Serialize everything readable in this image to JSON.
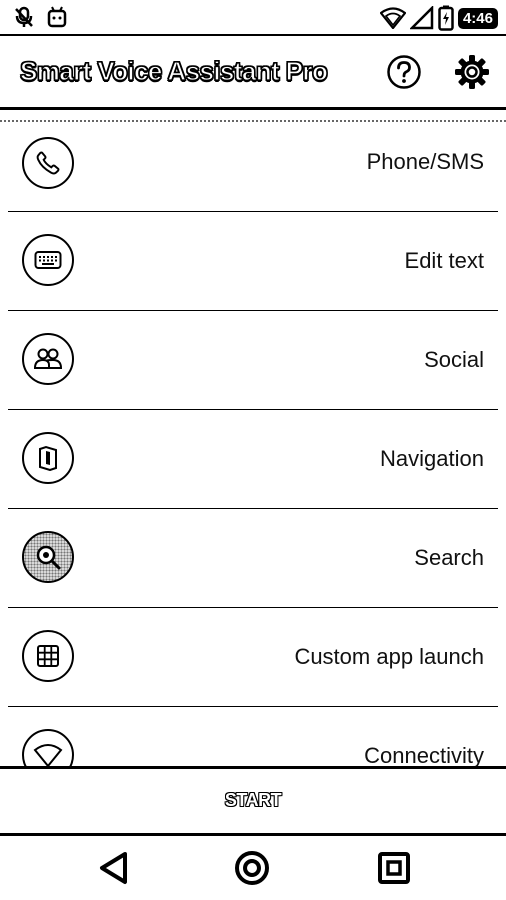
{
  "status_bar": {
    "time": "4:46",
    "left_icons": [
      "mic-off-icon",
      "android-icon"
    ],
    "right_icons": [
      "wifi-icon",
      "signal-icon",
      "battery-charging-icon"
    ]
  },
  "app_bar": {
    "title": "Smart Voice Assistant Pro",
    "actions": [
      "help-icon",
      "settings-gear-icon"
    ]
  },
  "list": {
    "items": [
      {
        "label": "Phone/SMS",
        "icon": "phone-icon"
      },
      {
        "label": "Edit text",
        "icon": "keyboard-icon"
      },
      {
        "label": "Social",
        "icon": "people-icon"
      },
      {
        "label": "Navigation",
        "icon": "map-icon"
      },
      {
        "label": "Search",
        "icon": "search-icon"
      },
      {
        "label": "Custom app launch",
        "icon": "grid-icon"
      },
      {
        "label": "Connectivity",
        "icon": "wifi-icon"
      }
    ]
  },
  "footer": {
    "start_label": "START"
  },
  "nav_bar": {
    "buttons": [
      "back-icon",
      "home-icon",
      "recents-icon"
    ]
  }
}
